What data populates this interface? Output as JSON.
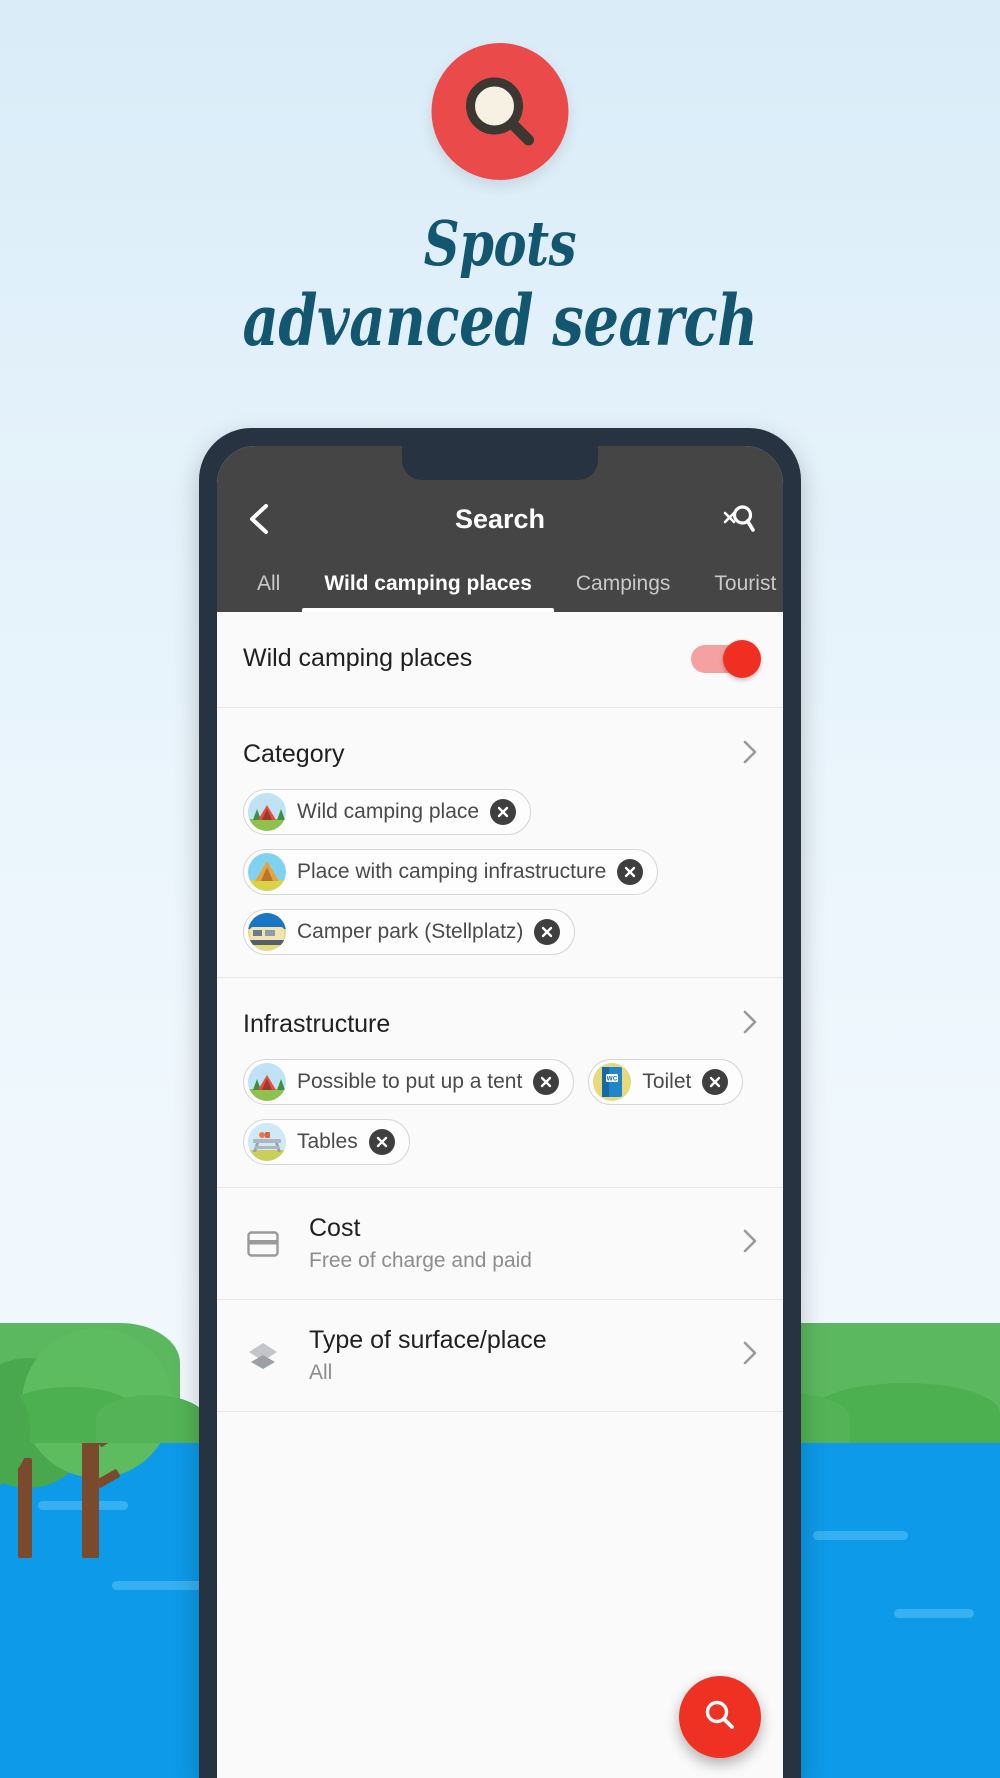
{
  "hero": {
    "icon": "magnifier-icon",
    "title_line1": "Spots",
    "title_line2": "advanced search",
    "accent_red": "#ea4a4a",
    "title_color": "#12566f"
  },
  "appbar": {
    "back_icon": "chevron-left-icon",
    "title": "Search",
    "action_icon": "search-off-icon",
    "background": "#454545"
  },
  "tabs": [
    {
      "label": "All",
      "active": false
    },
    {
      "label": "Wild camping places",
      "active": true
    },
    {
      "label": "Campings",
      "active": false
    },
    {
      "label": "Tourist",
      "active": false
    }
  ],
  "toggle_row": {
    "label": "Wild camping places",
    "state": "on",
    "track_color": "#f5a1a1",
    "thumb_color": "#f02f22"
  },
  "sections": [
    {
      "title": "Category",
      "chevron": "chevron-right-icon",
      "chips": [
        {
          "label": "Wild camping place",
          "icon": "tent-forest-icon",
          "remove_icon": "close-circle-icon"
        },
        {
          "label": "Place with camping infrastructure",
          "icon": "tent-orange-icon",
          "remove_icon": "close-circle-icon"
        },
        {
          "label": "Camper park (Stellplatz)",
          "icon": "camper-van-icon",
          "remove_icon": "close-circle-icon"
        }
      ]
    },
    {
      "title": "Infrastructure",
      "chevron": "chevron-right-icon",
      "chips": [
        {
          "label": "Possible to put up a tent",
          "icon": "tent-forest-icon",
          "remove_icon": "close-circle-icon"
        },
        {
          "label": "Toilet",
          "icon": "wc-sign-icon",
          "remove_icon": "close-circle-icon"
        },
        {
          "label": "Tables",
          "icon": "picnic-table-icon",
          "remove_icon": "close-circle-icon"
        }
      ]
    }
  ],
  "rows": [
    {
      "title": "Cost",
      "subtitle": "Free of charge and paid",
      "lead_icon": "credit-card-icon",
      "chevron": "chevron-right-icon"
    },
    {
      "title": "Type of surface/place",
      "subtitle": "All",
      "lead_icon": "layers-icon",
      "chevron": "chevron-right-icon"
    }
  ],
  "fab": {
    "icon": "search-icon",
    "color": "#ef3124"
  }
}
